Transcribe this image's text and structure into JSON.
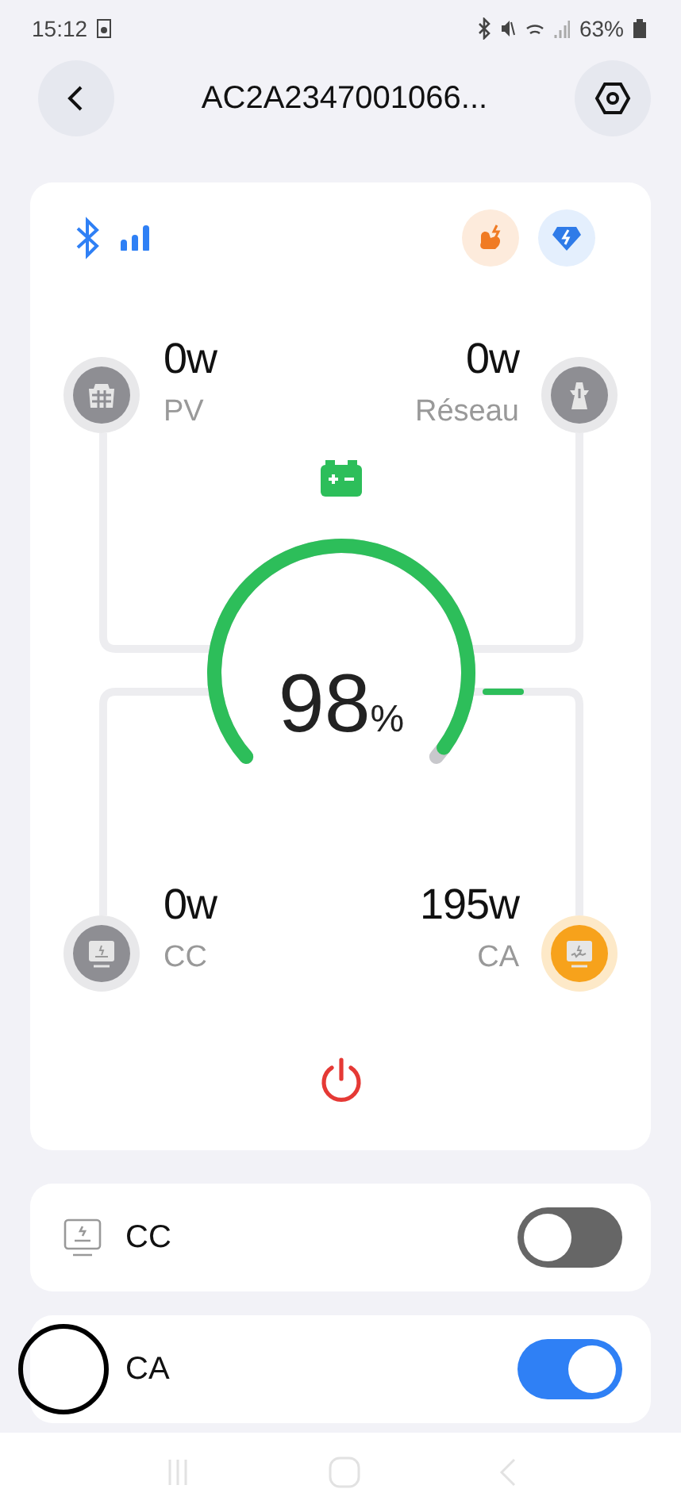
{
  "status_bar": {
    "time": "15:12",
    "battery": "63%"
  },
  "header": {
    "title": "AC2A2347001066..."
  },
  "flow": {
    "battery": {
      "value": "98",
      "unit": "%"
    },
    "nodes": [
      {
        "kind": "pv",
        "value": "0w",
        "label": "PV",
        "active": false
      },
      {
        "kind": "grid",
        "value": "0w",
        "label": "Réseau",
        "active": false
      },
      {
        "kind": "dc",
        "value": "0w",
        "label": "CC",
        "active": false
      },
      {
        "kind": "ac",
        "value": "195w",
        "label": "CA",
        "active": true
      }
    ]
  },
  "outputs": [
    {
      "kind": "dc",
      "label": "CC",
      "on": false
    },
    {
      "kind": "ac",
      "label": "CA",
      "on": true
    }
  ]
}
